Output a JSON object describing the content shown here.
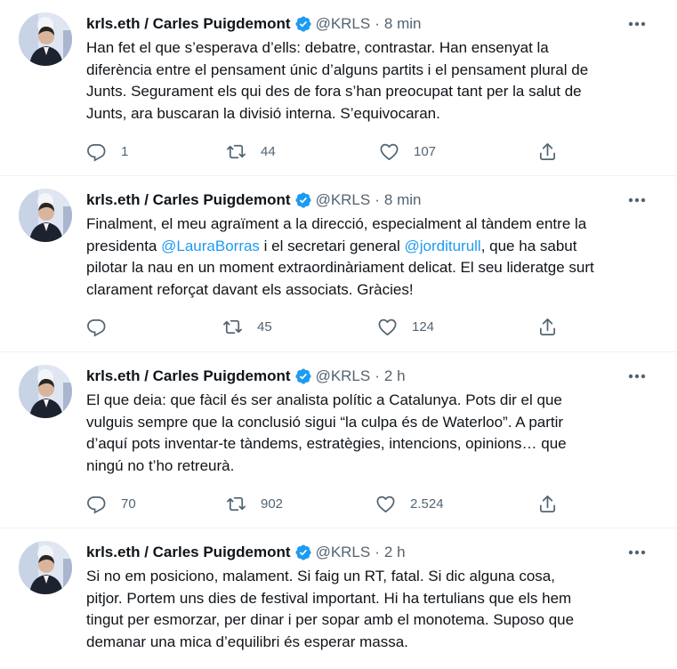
{
  "icons": {
    "verified": "verified-badge-icon",
    "more": "more-icon",
    "reply": "reply-icon",
    "retweet": "retweet-icon",
    "like": "like-icon",
    "share": "share-icon"
  },
  "colors": {
    "accent": "#1d9bf0",
    "text": "#0f1419",
    "secondary": "#536471",
    "divider": "#eff3f4"
  },
  "tweets": [
    {
      "name": "krls.eth / Carles Puigdemont",
      "handle": "@KRLS",
      "separator": "·",
      "time": "8 min",
      "lines": [
        "Han fet el que s’esperava d’ells: debatre, contrastar. Han ensenyat la",
        "diferència entre el pensament únic d’alguns partits i el pensament plural de",
        "Junts. Segurament els qui des de fora s’han preocupat tant per la salut de",
        "Junts, ara buscaran la divisió interna. S’equivocaran."
      ],
      "replies": "1",
      "retweets": "44",
      "likes": "107"
    },
    {
      "name": "krls.eth / Carles Puigdemont",
      "handle": "@KRLS",
      "separator": "·",
      "time": "8 min",
      "line1": "Finalment, el meu agraïment a la direcció, especialment al tàndem entre la",
      "line2_pre": "presidenta ",
      "mention1": "@LauraBorras",
      "line2_mid": " i el secretari general ",
      "mention2": "@jorditurull",
      "line2_post": ", que ha sabut",
      "line3": "pilotar la nau en un moment extraordinàriament delicat. El seu lideratge surt",
      "line4": "clarament reforçat davant els associats. Gràcies!",
      "replies": "",
      "retweets": "45",
      "likes": "124"
    },
    {
      "name": "krls.eth / Carles Puigdemont",
      "handle": "@KRLS",
      "separator": "·",
      "time": "2 h",
      "lines": [
        "El que deia: que fàcil és ser analista polític a Catalunya. Pots dir el que",
        "vulguis sempre que la conclusió sigui “la culpa és de Waterloo”. A partir",
        "d’aquí pots inventar-te tàndems, estratègies, intencions, opinions… que",
        "ningú no t’ho retreurà."
      ],
      "replies": "70",
      "retweets": "902",
      "likes": "2.524"
    },
    {
      "name": "krls.eth / Carles Puigdemont",
      "handle": "@KRLS",
      "separator": "·",
      "time": "2 h",
      "lines": [
        "Si no em posiciono, malament. Si faig un RT, fatal. Si dic alguna cosa,",
        "pitjor. Portem uns dies de festival important. Hi ha tertulians que els hem",
        "tingut per esmorzar, per dinar i per sopar amb el monotema. Suposo que",
        "demanar una mica d’equilibri és esperar massa."
      ]
    }
  ]
}
